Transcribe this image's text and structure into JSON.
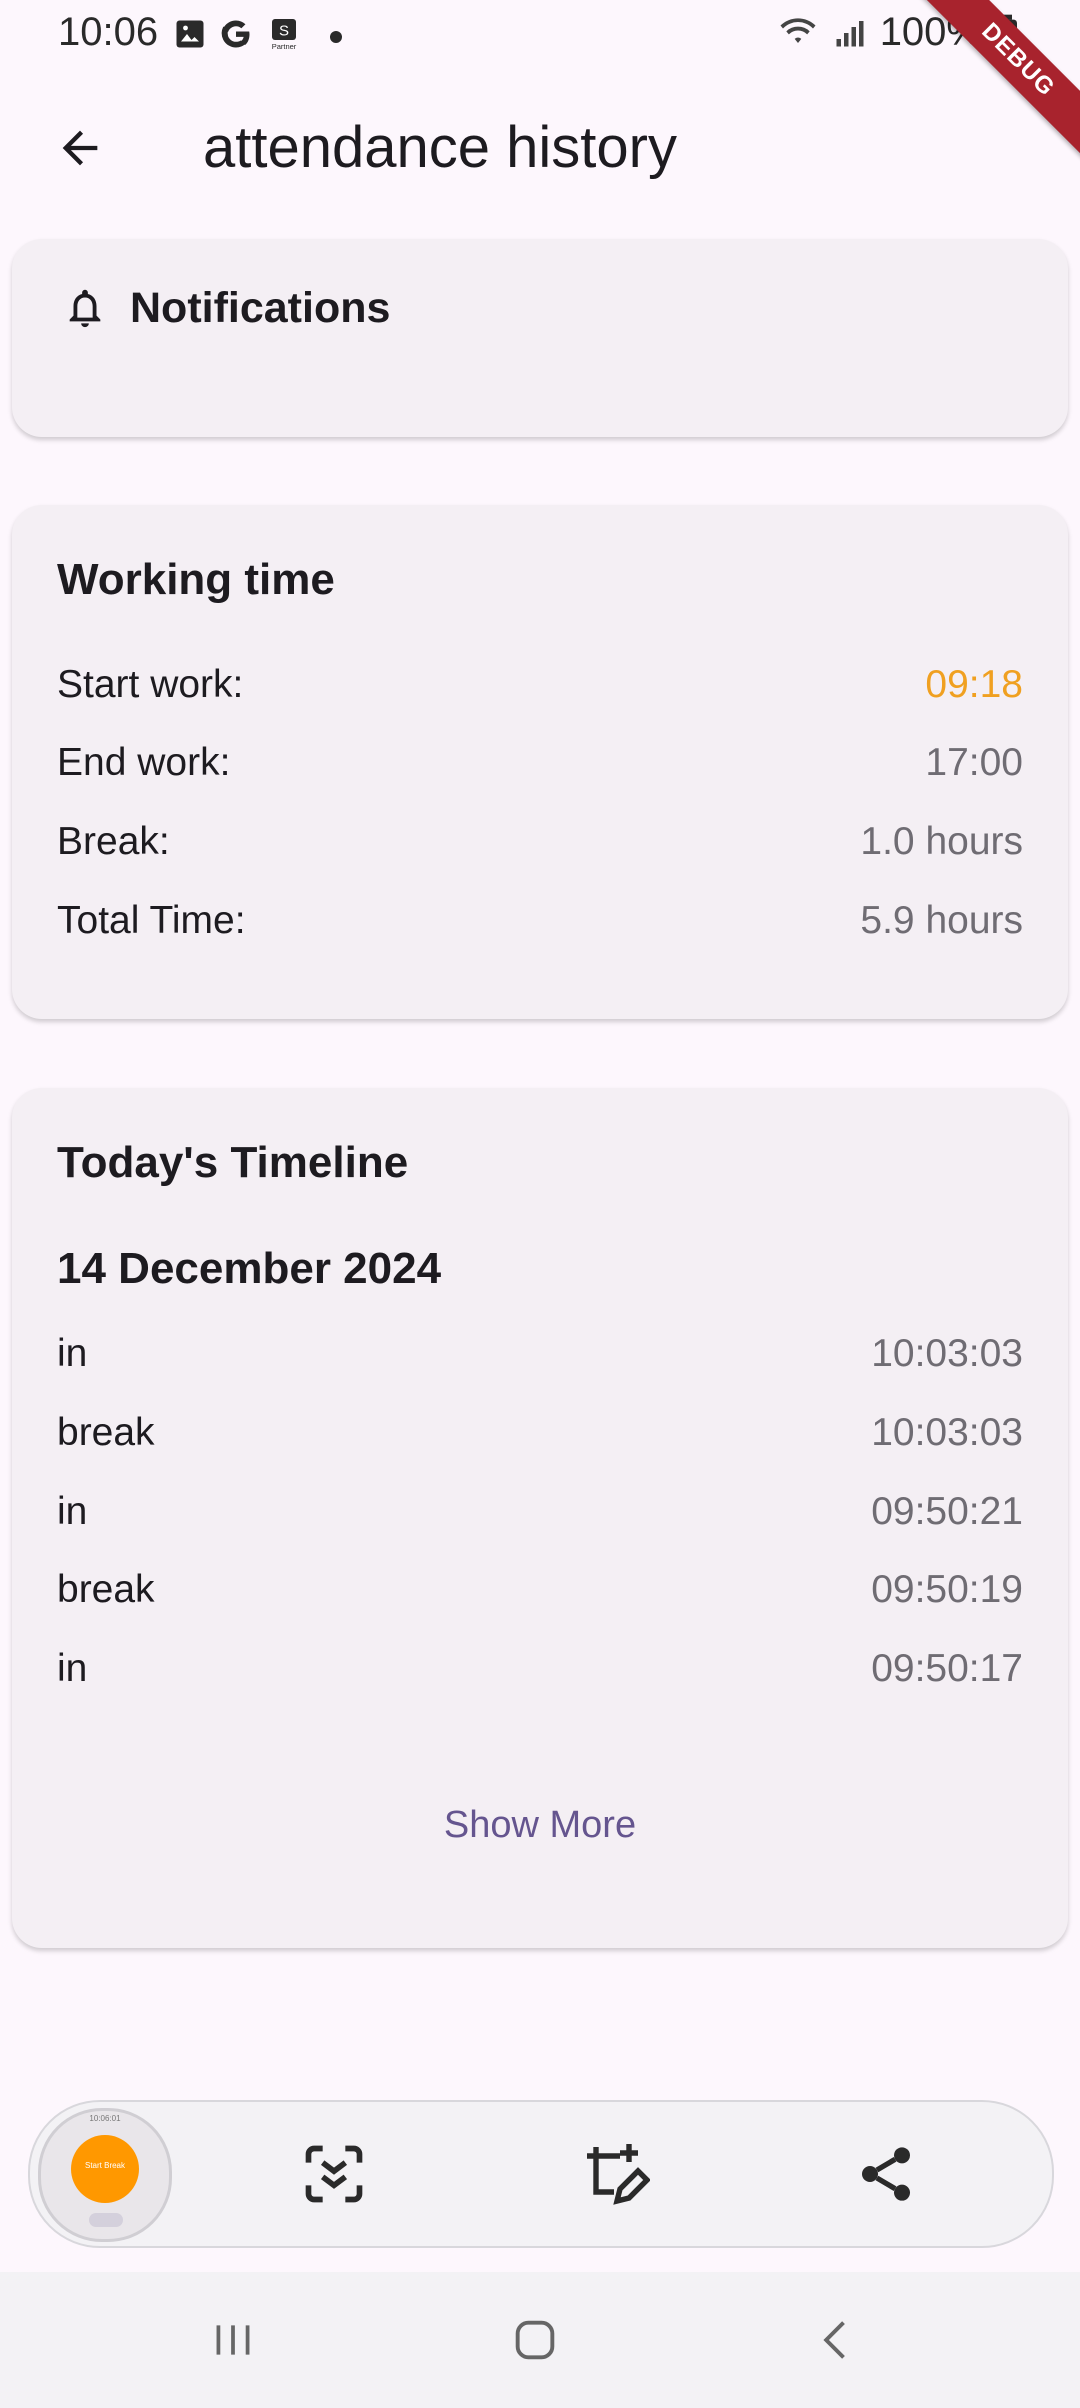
{
  "status_bar": {
    "time": "10:06",
    "notification_icons": [
      "image-icon",
      "google-icon",
      "partner-app-icon",
      "dot-icon"
    ],
    "battery_text": "100%",
    "debug_label": "DEBUG"
  },
  "app_bar": {
    "title": "attendance history"
  },
  "notifications": {
    "label": "Notifications"
  },
  "working_time": {
    "title": "Working time",
    "rows": [
      {
        "label": "Start work:",
        "value": "09:18"
      },
      {
        "label": "End work:",
        "value": "17:00"
      },
      {
        "label": "Break:",
        "value": "1.0 hours"
      },
      {
        "label": "Total Time:",
        "value": "5.9 hours"
      }
    ],
    "accent_color": "#f0a020"
  },
  "timeline": {
    "title": "Today's Timeline",
    "date": "14 December 2024",
    "entries": [
      {
        "type": "in",
        "time": "10:03:03"
      },
      {
        "type": "break",
        "time": "10:03:03"
      },
      {
        "type": "in",
        "time": "09:50:21"
      },
      {
        "type": "break",
        "time": "09:50:19"
      },
      {
        "type": "in",
        "time": "09:50:17"
      }
    ],
    "show_more_label": "Show More"
  },
  "capture_toolbar": {
    "thumbnail_time": "10:06:01",
    "thumbnail_button": "Start Break",
    "actions": [
      "scroll-capture-icon",
      "edit-crop-icon",
      "share-icon"
    ]
  },
  "colors": {
    "background": "#fdf7fd",
    "card": "#f4eff4",
    "link": "#65558f",
    "orange": "#ff9800"
  }
}
